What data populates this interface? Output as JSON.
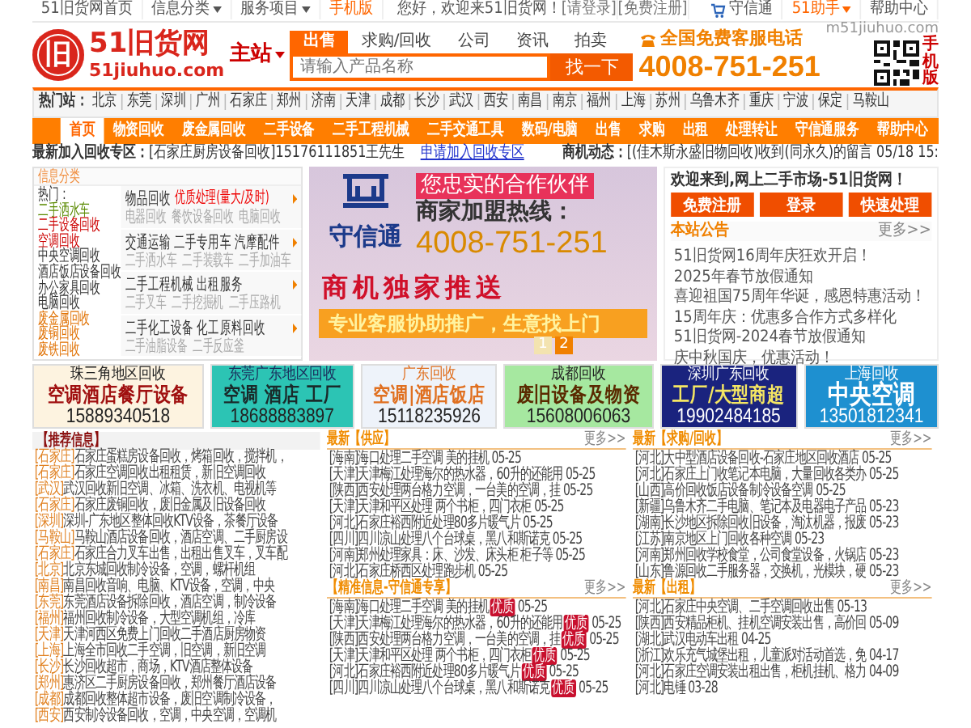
{
  "top_bar": {
    "links": [
      {
        "label": "51旧货网首页",
        "dropdown": false,
        "highlight": false
      },
      {
        "label": "信息分类",
        "dropdown": true,
        "highlight": false
      },
      {
        "label": "服务项目",
        "dropdown": true,
        "highlight": false
      },
      {
        "label": "手机版",
        "dropdown": false,
        "highlight": true
      }
    ],
    "greeting": "您好，欢迎来51旧货网！",
    "login": "[请登录]",
    "register": "[免费注册]",
    "right_links": [
      {
        "label": "守信通",
        "dropdown": false,
        "highlight": false
      },
      {
        "label": "51助手",
        "dropdown": true,
        "highlight": true
      },
      {
        "label": "帮助中心",
        "dropdown": false,
        "highlight": false
      }
    ]
  },
  "header": {
    "logo_glyph": "旧",
    "logo_title": "51旧货网",
    "logo_url": "51jiuhuo.com",
    "station": "主站",
    "station_dropdown": true,
    "search_tabs": [
      {
        "label": "出售",
        "selected": true
      },
      {
        "label": "求购/回收",
        "selected": false
      },
      {
        "label": "公司",
        "selected": false
      },
      {
        "label": "资讯",
        "selected": false
      },
      {
        "label": "拍卖",
        "selected": false
      }
    ],
    "search_placeholder": "请输入产品名称",
    "search_button": "找一下",
    "hotline_label": "全国免费客服电话",
    "hotline": "4008-751-251",
    "mobile_url": "m51jiuhuo.com",
    "mobile_label": "手机版"
  },
  "hot_cities": {
    "label": "热门站：",
    "cities": [
      "北京",
      "东莞",
      "深圳",
      "广州",
      "石家庄",
      "郑州",
      "济南",
      "天津",
      "成都",
      "长沙",
      "武汉",
      "西安",
      "南昌",
      "南京",
      "福州",
      "上海",
      "苏州",
      "乌鲁木齐",
      "重庆",
      "宁波",
      "保定",
      "马鞍山"
    ]
  },
  "nav": [
    {
      "label": "首页",
      "selected": true
    },
    {
      "label": "物资回收",
      "selected": false
    },
    {
      "label": "废金属回收",
      "selected": false
    },
    {
      "label": "二手设备",
      "selected": false
    },
    {
      "label": "二手工程机械",
      "selected": false
    },
    {
      "label": "二手交通工具",
      "selected": false
    },
    {
      "label": "数码/电脑",
      "selected": false
    },
    {
      "label": "出售",
      "selected": false
    },
    {
      "label": "求购",
      "selected": false
    },
    {
      "label": "出租",
      "selected": false
    },
    {
      "label": "处理转让",
      "selected": false
    },
    {
      "label": "守信通服务",
      "selected": false
    },
    {
      "label": "帮助中心",
      "selected": false
    }
  ],
  "ticker": {
    "label": "最新加入回收专区：",
    "entry": "[石家庄厨房设备回收]15176111851王先生",
    "link": "申请加入回收专区",
    "news_label": "商机动态：",
    "news": "[(佳木斯永盛旧物回收)收到(同永久)的留言 05/18 15:"
  },
  "category": {
    "title": "信息分类",
    "hot_label": "热门：",
    "hot_items": [
      {
        "label": "二手洒水车",
        "color": "#5a8a00"
      },
      {
        "label": "二手设备回收",
        "color": "#cc0000"
      },
      {
        "label": "空调回收",
        "color": "#cc0000"
      },
      {
        "label": "中央空调回收",
        "color": "#333333"
      },
      {
        "label": "酒店饭店设备回收",
        "color": "#333333"
      },
      {
        "label": "办公家具回收",
        "color": "#333333"
      },
      {
        "label": "电脑回收",
        "color": "#333333"
      },
      {
        "label": "废金属回收",
        "color": "#e07000"
      },
      {
        "label": "废铜回收",
        "color": "#e07000"
      },
      {
        "label": "废铁回收",
        "color": "#e07000"
      }
    ],
    "groups": [
      {
        "title": "物品回收",
        "highlight": "优质处理(量大/及时)",
        "subs": [
          "电器回收",
          "餐饮设备回收",
          "电脑回收"
        ]
      },
      {
        "title": "交通运输 二手专用车 汽摩配件",
        "subs": [
          "二手洒水车",
          "二手装载车",
          "二手加油车"
        ]
      },
      {
        "title": "二手工程机械 出租服务",
        "subs": [
          "二手叉车",
          "二手挖掘机",
          "二手压路机"
        ]
      },
      {
        "title": "二手化工设备 化工原料回收",
        "subs": [
          "二手油脂设备",
          "二手反应釜"
        ]
      }
    ]
  },
  "banner": {
    "brand": "守信通",
    "slogan": "您忠实的合作伙伴",
    "join_label": "商家加盟热线：",
    "join_phone": "4008-751-251",
    "push": "商机独家推送",
    "service": "专业客服协助推广，生意找上门",
    "pages": [
      {
        "label": "1",
        "selected": false
      },
      {
        "label": "2",
        "selected": true
      }
    ]
  },
  "welcome": {
    "title": "欢迎来到,网上二手市场-51旧货网！",
    "buttons": [
      "免费注册",
      "登录",
      "快速处理"
    ],
    "notice_title": "本站公告",
    "more": "更多>>",
    "notices": [
      "51旧货网16周年庆狂欢开启！",
      "2025年春节放假通知",
      "喜迎祖国75周年华诞，感恩特惠活动！",
      "15周年庆：优惠多合作方式多样化",
      "51旧货网-2024春节放假通知",
      "庆中秋国庆，优惠活动！"
    ]
  },
  "ads": [
    {
      "region": "珠三角地区回收",
      "headline": "空调酒店餐厅设备",
      "phone": "15889340518",
      "color": "#fdf3e0",
      "kind": "cream"
    },
    {
      "region": "东莞广东地区回收",
      "headline": "空调 酒店 工厂",
      "phone": "18688883897",
      "color": "#2cc4b4",
      "kind": "teal"
    },
    {
      "region": "广东回收",
      "headline": "空调|酒店饭店",
      "phone": "15118235926",
      "color": "#eef3fa",
      "kind": "pale"
    },
    {
      "region": "成都回收",
      "headline": "废旧设备及物资",
      "phone": "15608006063",
      "color": "#a6e8a0",
      "kind": "mint"
    },
    {
      "region": "深圳广东回收",
      "headline": "工厂/大型商超",
      "phone": "19902484185",
      "color": "#1a237e",
      "kind": "navy"
    },
    {
      "region": "上海回收",
      "headline": "中央空调",
      "phone": "13501812341",
      "color": "#1e90d0",
      "kind": "sky"
    }
  ],
  "recommend": {
    "title": "【推荐信息】",
    "items": [
      {
        "region": "[石家庄]",
        "text": "石家庄蛋糕房设备回收，烤箱回收，搅拌机，"
      },
      {
        "region": "[石家庄]",
        "text": "石家庄空调回收出租租赁，新旧空调回收"
      },
      {
        "region": "[武汉]",
        "text": "武汉回收新旧空调、冰箱、洗衣机、电视机等"
      },
      {
        "region": "[石家庄]",
        "text": "石家庄废铜回收，废旧金属及旧设备回收"
      },
      {
        "region": "[深圳]",
        "text": "深圳-广东地区整体回收KTV设备，茶餐厅设备"
      },
      {
        "region": "[马鞍山]",
        "text": "马鞍山酒店设备回收，酒店空调、二手厨房设"
      },
      {
        "region": "[石家庄]",
        "text": "石家庄合力叉车出售，出租出售叉车，叉车配"
      },
      {
        "region": "[北京]",
        "text": "北京东城回收制冷设备，空调，螺杆机组"
      },
      {
        "region": "[南昌]",
        "text": "南昌回收音响、电脑、KTV设备，空调，中央"
      },
      {
        "region": "[东莞]",
        "text": "东莞酒店设备拆除回收，酒店空调，制冷设备"
      },
      {
        "region": "[福州]",
        "text": "福州回收制冷设备，大型空调机组，冷库"
      },
      {
        "region": "[天津]",
        "text": "天津河西区免费上门回收二手酒店厨房物资"
      },
      {
        "region": "[上海]",
        "text": "上海全市回收二手空调，旧空调，新旧空调"
      },
      {
        "region": "[长沙]",
        "text": "长沙回收超市，商场，KTV酒店整体设备"
      },
      {
        "region": "[郑州]",
        "text": "惠济区二手厨房设备回收，郑州餐厅酒店设备"
      },
      {
        "region": "[成都]",
        "text": "成都回收整体超市设备，废旧空调制冷设备，"
      },
      {
        "region": "[西安]",
        "text": "西安制冷设备回收，空调，中央空调，空调机"
      }
    ]
  },
  "boxes": [
    {
      "title": "最新【供应】",
      "more": "更多>>",
      "items": [
        {
          "region": "[海南]",
          "text": "海口处理二手空调 美的挂机",
          "date": "05-25"
        },
        {
          "region": "[天津]",
          "text": "天津梅江处理海尔的热水器，60升的还能用",
          "date": "05-25"
        },
        {
          "region": "[陕西]",
          "text": "西安处理两台格力空调，一台美的空调，挂",
          "date": "05-25"
        },
        {
          "region": "[天津]",
          "text": "天津和平区处理 两个书柜，四门衣柜",
          "date": "05-25"
        },
        {
          "region": "[河北]",
          "text": "石家庄裕西附近处理80多片暖气片",
          "date": "05-25"
        },
        {
          "region": "[四川]",
          "text": "四川凉山处理八个台球桌，黑八和斯诺克",
          "date": "05-25"
        },
        {
          "region": "[河南]",
          "text": "郑州处理家具：床、沙发、床头柜 柜子等",
          "date": "05-25"
        },
        {
          "region": "[河北]",
          "text": "石家庄桥西区处理跑步机",
          "date": "05-25"
        }
      ]
    },
    {
      "title": "最新【求购/回收】",
      "more": "更多>>",
      "items": [
        {
          "region": "[河北]",
          "text": "大中型酒店设备回收-石家庄地区回收酒店",
          "date": "05-25"
        },
        {
          "region": "[河北]",
          "text": "石家庄上门收笔记本电脑，大量回收各类办",
          "date": "05-25"
        },
        {
          "region": "[山西]",
          "text": "高价回收饭店设备制冷设备空调",
          "date": "05-25"
        },
        {
          "region": "[新疆]",
          "text": "乌鲁木齐二手电脑、笔记本及电器电子产品",
          "date": "05-23"
        },
        {
          "region": "[湖南]",
          "text": "长沙地区拆除回收旧设备，淘汰机器，报废",
          "date": "05-23"
        },
        {
          "region": "[江苏]",
          "text": "南京地区上门回收各种空调",
          "date": "05-23"
        },
        {
          "region": "[河南]",
          "text": "郑州回收学校食堂，公司食堂设备，火锅店",
          "date": "05-23"
        },
        {
          "region": "[山东]",
          "text": "鲁源回收二手服务器，交换机，光模块，硬",
          "date": "05-23"
        }
      ]
    },
    {
      "title": "【精准信息-守信通专享】",
      "more": "更多>>",
      "items": [
        {
          "region": "[海南]",
          "text": "海口处理二手空调 美的挂机",
          "badge": "优质",
          "date": "05-25"
        },
        {
          "region": "[天津]",
          "text": "天津梅江处理海尔的热水器，60升的还能用",
          "badge": "优质",
          "date": "05-25"
        },
        {
          "region": "[陕西]",
          "text": "西安处理两台格力空调，一台美的空调，挂",
          "badge": "优质",
          "date": "05-25"
        },
        {
          "region": "[天津]",
          "text": "天津和平区处理 两个书柜，四门衣柜",
          "badge": "优质",
          "date": "05-25"
        },
        {
          "region": "[河北]",
          "text": "石家庄裕西附近处理80多片暖气片",
          "badge": "优质",
          "date": "05-25"
        },
        {
          "region": "[四川]",
          "text": "四川凉山处理八个台球桌，黑八和斯诺克",
          "badge": "优质",
          "date": "05-25"
        }
      ]
    },
    {
      "title": "最新【出租】",
      "more": "更多>>",
      "items": [
        {
          "region": "[河北]",
          "text": "石家庄中央空调、二手空调回收出售",
          "date": "05-13"
        },
        {
          "region": "[陕西]",
          "text": "西安精品柜机、挂机空调安装出售，高价回",
          "date": "05-09"
        },
        {
          "region": "[湖北]",
          "text": "武汉电动车出租",
          "date": "04-25"
        },
        {
          "region": "[浙江]",
          "text": "欢乐充气城堡出租，儿童派对活动首选，免",
          "date": "04-17"
        },
        {
          "region": "[河北]",
          "text": "石家庄空调安装出租出售，柜机挂机、格力",
          "date": "04-09"
        },
        {
          "region": "[河北]",
          "text": "电锤",
          "date": "03-28"
        }
      ]
    }
  ]
}
